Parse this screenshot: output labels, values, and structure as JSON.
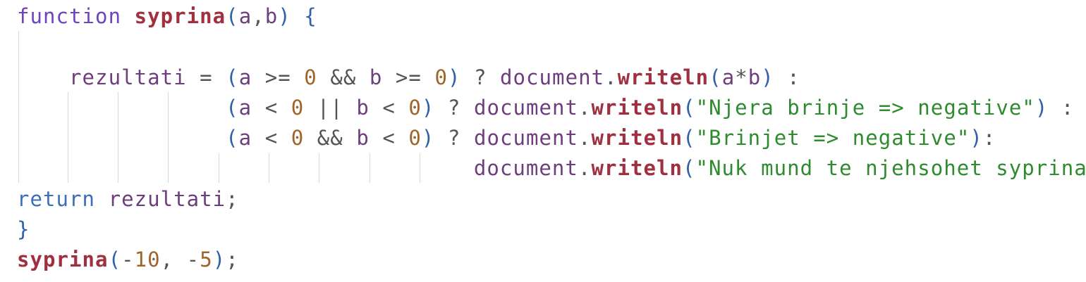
{
  "code": {
    "language": "javascript",
    "lines": [
      "function syprina(a,b) {",
      "",
      "    rezultati = (a >= 0 && b >= 0) ? document.writeln(a*b) :",
      "                (a < 0 || b < 0) ? document.writeln(\"Njera brinje => negative\") :",
      "                (a < 0 && b < 0) ? document.writeln(\"Brinjet => negative\"):",
      "                                   document.writeln(\"Nuk mund te njehsohet syprina\")",
      "return rezultati;",
      "}",
      "syprina(-10, -5);"
    ]
  },
  "colors": {
    "background": "#ffffff",
    "keyword": "#6f42c1",
    "function_name": "#a0303f",
    "identifier": "#6e3d7e",
    "number": "#a0642a",
    "string": "#2e8b2e",
    "bracket_level1": "#3060a8",
    "bracket_level2": "#2e8b2e",
    "indent_guide": "#d8d8d8"
  }
}
